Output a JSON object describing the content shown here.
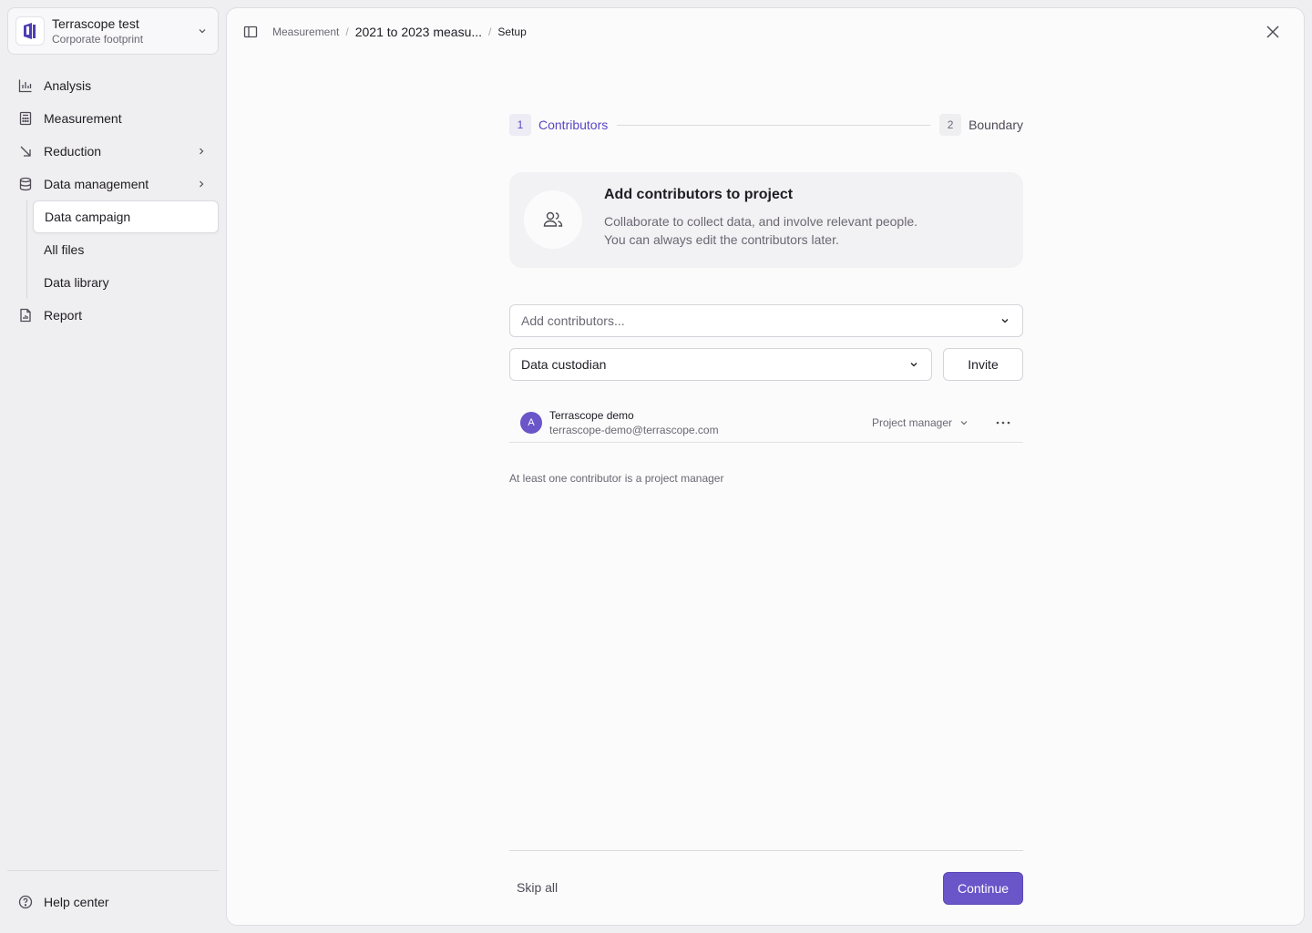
{
  "org": {
    "name": "Terrascope test",
    "subtitle": "Corporate footprint"
  },
  "nav": {
    "analysis": "Analysis",
    "measurement": "Measurement",
    "reduction": "Reduction",
    "data_management": "Data management",
    "sub_items": {
      "data_campaign": "Data campaign",
      "all_files": "All files",
      "data_library": "Data library"
    },
    "report": "Report",
    "help": "Help center"
  },
  "breadcrumb": {
    "root": "Measurement",
    "project": "2021 to 2023 measu...",
    "current": "Setup"
  },
  "stepper": {
    "steps": [
      {
        "number": "1",
        "label": "Contributors",
        "active": true
      },
      {
        "number": "2",
        "label": "Boundary",
        "active": false
      }
    ]
  },
  "info_card": {
    "title": "Add contributors to project",
    "line1": "Collaborate to collect data, and involve relevant people.",
    "line2": "You can always edit the contributors later."
  },
  "contributors_select": {
    "placeholder": "Add contributors..."
  },
  "role_select": {
    "value": "Data custodian"
  },
  "invite_label": "Invite",
  "contributors": [
    {
      "initial": "A",
      "name": "Terrascope demo",
      "email": "terrascope-demo@terrascope.com",
      "role": "Project manager"
    }
  ],
  "note": "At least one contributor is a project manager",
  "footer": {
    "skip": "Skip all",
    "continue": "Continue"
  },
  "colors": {
    "accent": "#6a55c9",
    "accent_text": "#5a46c2",
    "background": "#efeef0",
    "panel": "#fbfbfb"
  },
  "icons": {
    "org_logo": "terrascope-logo-icon",
    "analysis": "bar-chart-icon",
    "measurement": "calculator-icon",
    "reduction": "arrow-down-right-icon",
    "data_management": "database-icon",
    "report": "document-chart-icon",
    "help": "question-circle-icon",
    "panel_toggle": "sidebar-toggle-icon",
    "close": "close-icon",
    "users": "users-icon",
    "more": "more-horizontal-icon"
  }
}
